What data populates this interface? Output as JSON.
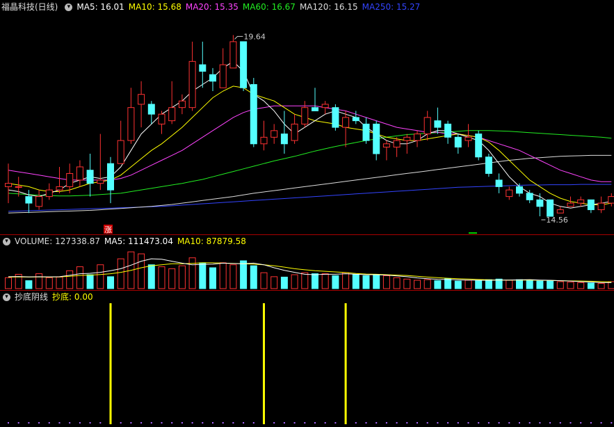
{
  "stock": {
    "title": "福晶科技(日线)"
  },
  "ma_legend": [
    {
      "label": "MA5: 16.01",
      "color": "#ffffff"
    },
    {
      "label": "MA10: 15.68",
      "color": "#ffff00"
    },
    {
      "label": "MA20: 15.35",
      "color": "#ff44ff"
    },
    {
      "label": "MA60: 16.67",
      "color": "#22ee22"
    },
    {
      "label": "MA120: 16.15",
      "color": "#dddddd"
    },
    {
      "label": "MA250: 15.27",
      "color": "#3344ff"
    }
  ],
  "volume_legend": [
    {
      "label": "VOLUME: 127338.87",
      "color": "#dddddd"
    },
    {
      "label": "MA5: 111473.04",
      "color": "#ffffff"
    },
    {
      "label": "MA10: 87879.58",
      "color": "#ffff00"
    }
  ],
  "indicator_legend": [
    {
      "label": "抄底阴线",
      "color": "#dddddd"
    },
    {
      "label": "抄底: 0.00",
      "color": "#ffff00"
    }
  ],
  "annotations": {
    "high": "19.64",
    "low": "14.56",
    "up_marker": "涨"
  },
  "colors": {
    "up": "#ff3232",
    "down": "#54ffff",
    "separator": "#aa0000"
  },
  "chart_data": [
    {
      "type": "candlestick",
      "ylim": [
        13.9,
        20.4
      ],
      "candles": [
        [
          15.2,
          15.3,
          15.9,
          14.7
        ],
        [
          15.2,
          15.2,
          15.5,
          14.9
        ],
        [
          14.9,
          14.7,
          15.1,
          14.4
        ],
        [
          14.6,
          14.9,
          15.1,
          14.5
        ],
        [
          14.9,
          15.1,
          15.3,
          14.8
        ],
        [
          15.1,
          15.2,
          15.8,
          15.0
        ],
        [
          15.2,
          15.6,
          15.9,
          15.0
        ],
        [
          15.4,
          15.8,
          16.0,
          15.2
        ],
        [
          15.7,
          15.3,
          16.2,
          14.9
        ],
        [
          15.3,
          15.4,
          16.8,
          15.1
        ],
        [
          15.9,
          15.1,
          16.1,
          14.7
        ],
        [
          15.9,
          16.6,
          17.2,
          15.9
        ],
        [
          16.6,
          17.6,
          18.2,
          16.5
        ],
        [
          17.7,
          18.0,
          18.4,
          17.0
        ],
        [
          17.7,
          17.4,
          17.8,
          17.1
        ],
        [
          17.1,
          17.4,
          17.5,
          16.8
        ],
        [
          17.2,
          17.6,
          18.4,
          17.1
        ],
        [
          17.6,
          17.8,
          18.0,
          17.4
        ],
        [
          17.6,
          19.0,
          19.6,
          17.5
        ],
        [
          18.9,
          18.7,
          19.6,
          18.2
        ],
        [
          18.6,
          18.4,
          18.8,
          18.1
        ],
        [
          18.2,
          18.9,
          19.4,
          18.2
        ],
        [
          18.8,
          19.6,
          19.8,
          18.9
        ],
        [
          19.6,
          18.2,
          19.6,
          18.1
        ],
        [
          18.3,
          16.5,
          18.5,
          16.4
        ],
        [
          16.5,
          16.7,
          17.2,
          16.3
        ],
        [
          16.7,
          16.9,
          17.1,
          16.5
        ],
        [
          16.8,
          16.5,
          17.5,
          16.2
        ],
        [
          16.6,
          17.1,
          17.4,
          16.5
        ],
        [
          17.1,
          17.6,
          17.8,
          17.0
        ],
        [
          17.6,
          17.5,
          18.2,
          17.5
        ],
        [
          17.6,
          17.7,
          17.8,
          17.4
        ],
        [
          17.6,
          17.0,
          17.7,
          16.9
        ],
        [
          17.0,
          17.3,
          17.5,
          16.4
        ],
        [
          17.3,
          17.2,
          17.5,
          17.1
        ],
        [
          17.1,
          16.6,
          17.3,
          16.5
        ],
        [
          17.1,
          16.2,
          17.2,
          16.0
        ],
        [
          16.4,
          16.5,
          16.6,
          16.0
        ],
        [
          16.4,
          16.6,
          16.7,
          16.1
        ],
        [
          16.6,
          16.7,
          16.8,
          16.2
        ],
        [
          16.6,
          16.8,
          16.9,
          16.4
        ],
        [
          16.8,
          17.3,
          17.5,
          16.6
        ],
        [
          17.2,
          17.0,
          17.6,
          16.8
        ],
        [
          17.1,
          16.7,
          17.2,
          16.5
        ],
        [
          16.7,
          16.4,
          16.8,
          16.2
        ],
        [
          16.6,
          16.7,
          17.1,
          16.4
        ],
        [
          16.8,
          16.1,
          16.9,
          16.0
        ],
        [
          16.1,
          15.6,
          16.2,
          15.5
        ],
        [
          15.4,
          15.2,
          15.6,
          15.0
        ],
        [
          14.9,
          15.1,
          15.2,
          14.8
        ],
        [
          15.2,
          15.0,
          15.3,
          14.9
        ],
        [
          15.0,
          14.8,
          15.1,
          14.7
        ],
        [
          14.8,
          14.6,
          15.0,
          14.3
        ],
        [
          14.8,
          14.3,
          14.8,
          14.3
        ],
        [
          14.4,
          14.5,
          14.6,
          14.4
        ],
        [
          14.6,
          14.7,
          14.9,
          14.6
        ],
        [
          14.7,
          14.8,
          14.9,
          14.6
        ],
        [
          14.8,
          14.5,
          14.8,
          14.4
        ],
        [
          14.5,
          14.7,
          14.9,
          14.4
        ],
        [
          14.7,
          14.9,
          15.0,
          14.6
        ]
      ],
      "ma_lines": [
        {
          "name": "MA5",
          "color": "#ffffff",
          "values": [
            15.1,
            15.05,
            14.95,
            14.9,
            15.0,
            15.1,
            15.3,
            15.4,
            15.5,
            15.45,
            15.5,
            15.8,
            16.3,
            16.8,
            17.1,
            17.4,
            17.6,
            17.8,
            18.1,
            18.3,
            18.5,
            18.8,
            19.0,
            18.7,
            18.0,
            17.8,
            17.5,
            17.1,
            16.8,
            17.0,
            17.2,
            17.4,
            17.5,
            17.4,
            17.3,
            17.0,
            16.8,
            16.6,
            16.5,
            16.5,
            16.6,
            16.8,
            16.9,
            16.9,
            16.8,
            16.7,
            16.6,
            16.3,
            15.9,
            15.5,
            15.2,
            15.0,
            14.9,
            14.7,
            14.6,
            14.55,
            14.6,
            14.65,
            14.7,
            14.75
          ]
        },
        {
          "name": "MA10",
          "color": "#ffff00",
          "values": [
            15.3,
            15.25,
            15.2,
            15.1,
            15.05,
            15.05,
            15.1,
            15.2,
            15.3,
            15.35,
            15.4,
            15.55,
            15.8,
            16.05,
            16.3,
            16.5,
            16.75,
            17.0,
            17.3,
            17.6,
            17.9,
            18.1,
            18.25,
            18.2,
            18.0,
            17.9,
            17.8,
            17.6,
            17.4,
            17.3,
            17.2,
            17.15,
            17.1,
            17.0,
            16.95,
            16.9,
            16.8,
            16.7,
            16.65,
            16.6,
            16.6,
            16.65,
            16.7,
            16.75,
            16.8,
            16.75,
            16.7,
            16.55,
            16.3,
            16.0,
            15.7,
            15.4,
            15.2,
            15.0,
            14.85,
            14.75,
            14.7,
            14.65,
            14.65,
            14.7
          ]
        },
        {
          "name": "MA20",
          "color": "#ff44ff",
          "values": [
            15.7,
            15.65,
            15.6,
            15.55,
            15.5,
            15.45,
            15.4,
            15.4,
            15.4,
            15.4,
            15.4,
            15.45,
            15.55,
            15.7,
            15.85,
            16.0,
            16.15,
            16.3,
            16.5,
            16.7,
            16.9,
            17.1,
            17.3,
            17.45,
            17.55,
            17.6,
            17.65,
            17.65,
            17.65,
            17.65,
            17.65,
            17.6,
            17.55,
            17.5,
            17.4,
            17.3,
            17.2,
            17.1,
            17.0,
            16.95,
            16.9,
            16.85,
            16.85,
            16.8,
            16.8,
            16.75,
            16.7,
            16.6,
            16.5,
            16.4,
            16.3,
            16.15,
            16.0,
            15.85,
            15.7,
            15.6,
            15.5,
            15.4,
            15.35,
            15.35
          ]
        },
        {
          "name": "MA60",
          "color": "#22ee22",
          "values": [
            15.0,
            14.98,
            14.96,
            14.94,
            14.93,
            14.92,
            14.92,
            14.93,
            14.94,
            14.96,
            14.98,
            15.0,
            15.05,
            15.1,
            15.15,
            15.2,
            15.25,
            15.3,
            15.36,
            15.42,
            15.5,
            15.58,
            15.66,
            15.74,
            15.82,
            15.9,
            15.98,
            16.05,
            16.12,
            16.2,
            16.28,
            16.35,
            16.42,
            16.48,
            16.54,
            16.6,
            16.65,
            16.7,
            16.74,
            16.78,
            16.8,
            16.82,
            16.84,
            16.86,
            16.88,
            16.9,
            16.9,
            16.9,
            16.89,
            16.88,
            16.86,
            16.84,
            16.82,
            16.8,
            16.78,
            16.76,
            16.74,
            16.72,
            16.7,
            16.67
          ]
        },
        {
          "name": "MA120",
          "color": "#dddddd",
          "values": [
            14.4,
            14.41,
            14.42,
            14.43,
            14.44,
            14.45,
            14.46,
            14.47,
            14.48,
            14.5,
            14.52,
            14.54,
            14.56,
            14.58,
            14.6,
            14.63,
            14.66,
            14.7,
            14.74,
            14.78,
            14.82,
            14.86,
            14.9,
            14.95,
            15.0,
            15.04,
            15.08,
            15.12,
            15.16,
            15.2,
            15.24,
            15.28,
            15.32,
            15.36,
            15.4,
            15.44,
            15.48,
            15.52,
            15.56,
            15.6,
            15.64,
            15.68,
            15.72,
            15.76,
            15.8,
            15.84,
            15.88,
            15.92,
            15.96,
            16.0,
            16.03,
            16.06,
            16.08,
            16.1,
            16.12,
            16.13,
            16.14,
            16.15,
            16.15,
            16.15
          ]
        },
        {
          "name": "MA250",
          "color": "#3344ff",
          "values": [
            14.45,
            14.46,
            14.47,
            14.48,
            14.49,
            14.5,
            14.51,
            14.52,
            14.53,
            14.54,
            14.55,
            14.56,
            14.57,
            14.58,
            14.59,
            14.6,
            14.62,
            14.64,
            14.66,
            14.68,
            14.7,
            14.72,
            14.74,
            14.76,
            14.78,
            14.8,
            14.82,
            14.84,
            14.86,
            14.88,
            14.9,
            14.92,
            14.94,
            14.96,
            14.98,
            15.0,
            15.02,
            15.04,
            15.06,
            15.08,
            15.1,
            15.12,
            15.14,
            15.16,
            15.18,
            15.19,
            15.2,
            15.21,
            15.22,
            15.23,
            15.24,
            15.25,
            15.25,
            15.26,
            15.26,
            15.26,
            15.27,
            15.27,
            15.27,
            15.27
          ]
        }
      ]
    },
    {
      "type": "bar",
      "title": "VOLUME",
      "ylim": [
        0,
        210000
      ],
      "values": [
        55000,
        72000,
        40000,
        75000,
        55000,
        58000,
        90000,
        110000,
        70000,
        120000,
        60000,
        150000,
        185000,
        175000,
        120000,
        110000,
        100000,
        115000,
        155000,
        130000,
        105000,
        130000,
        120000,
        140000,
        115000,
        80000,
        60000,
        58000,
        70000,
        80000,
        75000,
        75000,
        65000,
        80000,
        70000,
        65000,
        70000,
        65000,
        55000,
        48000,
        42000,
        45000,
        40000,
        50000,
        38000,
        42000,
        40000,
        45000,
        48000,
        42000,
        45000,
        44000,
        38000,
        40000,
        35000,
        33000,
        30000,
        28000,
        26000,
        35000
      ],
      "ma5": [
        60000,
        61000,
        59000,
        60000,
        59000,
        60000,
        67000,
        75000,
        77000,
        82000,
        90000,
        100000,
        118000,
        138000,
        150000,
        148000,
        138000,
        128000,
        120000,
        122000,
        123000,
        128000,
        126000,
        125000,
        128000,
        120000,
        105000,
        92000,
        82000,
        72000,
        70000,
        72000,
        72000,
        75000,
        72000,
        70000,
        70000,
        68000,
        64000,
        60000,
        54000,
        50000,
        47000,
        46000,
        44000,
        43000,
        42000,
        42000,
        43000,
        43000,
        44000,
        45000,
        43000,
        42000,
        40000,
        38000,
        35000,
        33000,
        30000,
        30000
      ],
      "ma10": [
        58000,
        58500,
        58000,
        58500,
        58000,
        59000,
        62000,
        66000,
        68000,
        71000,
        75000,
        82000,
        92000,
        105000,
        115000,
        120000,
        125000,
        125000,
        127000,
        130000,
        130000,
        128000,
        127000,
        125000,
        123000,
        120000,
        115000,
        108000,
        100000,
        95000,
        90000,
        87000,
        84000,
        81000,
        76000,
        73000,
        72000,
        70000,
        68000,
        66000,
        62000,
        58000,
        55000,
        52000,
        50000,
        48000,
        46000,
        44000,
        43000,
        43000,
        43000,
        43000,
        42000,
        41000,
        40000,
        39000,
        38000,
        37000,
        35000,
        34000
      ],
      "legend_values": {
        "volume": 127338.87,
        "ma5": 111473.04,
        "ma10": 87879.58
      }
    },
    {
      "type": "bar",
      "title": "抄底阴线",
      "values_by_index": {
        "10": 1,
        "25": 1,
        "33": 1
      },
      "current": 0.0
    }
  ]
}
